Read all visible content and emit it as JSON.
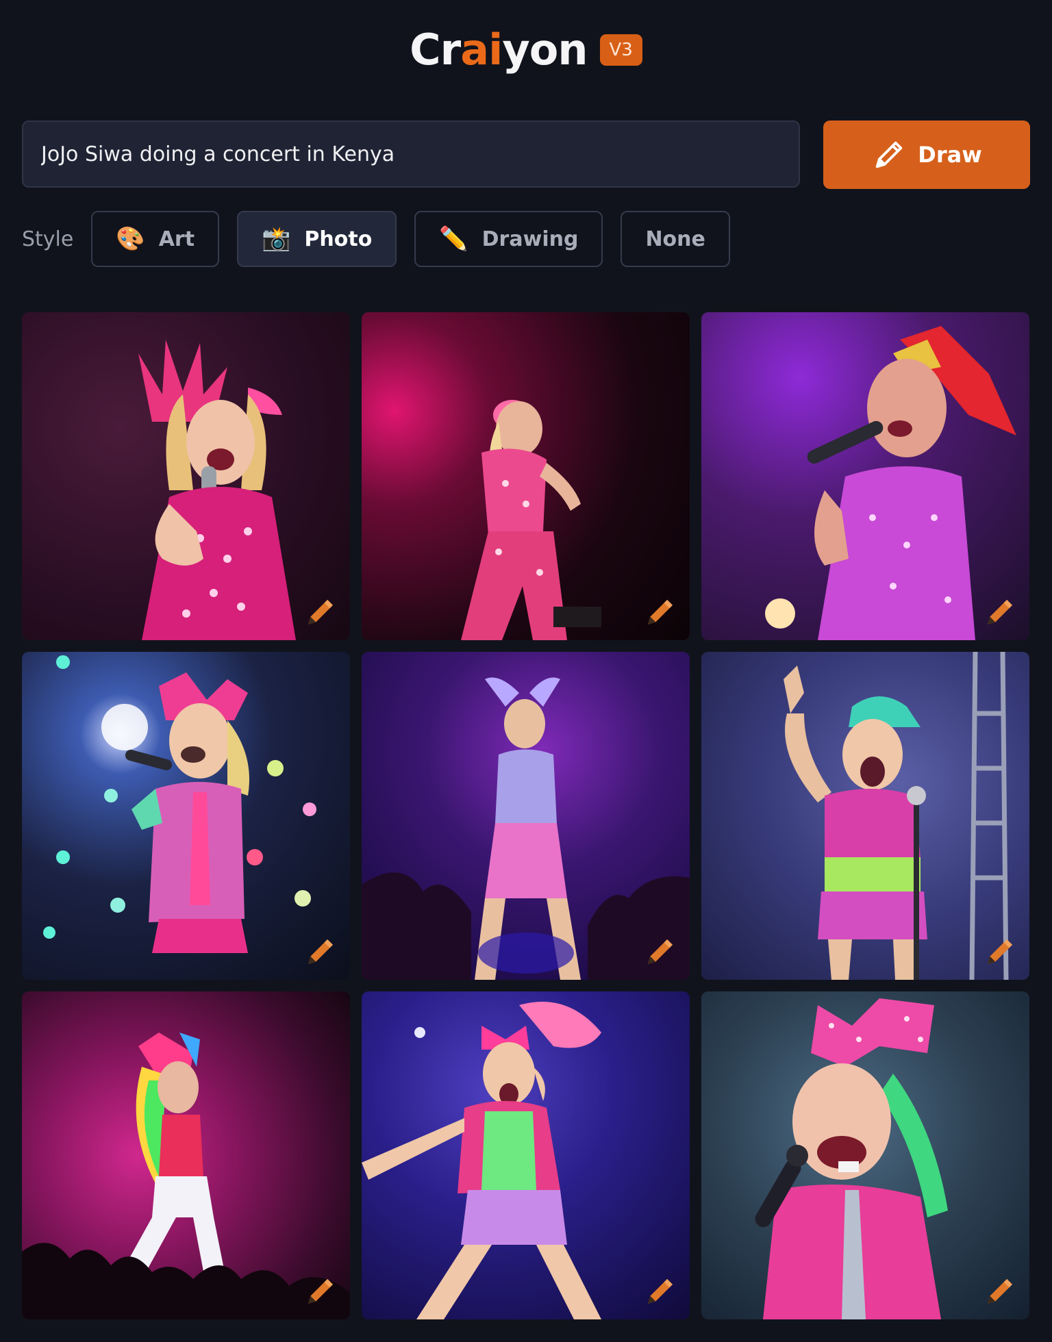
{
  "header": {
    "logo_prefix": "Cr",
    "logo_accent": "ai",
    "logo_suffix": "yon",
    "version_badge": "V3"
  },
  "prompt": {
    "value": "JoJo Siwa doing a concert in Kenya"
  },
  "draw_button": {
    "label": "Draw",
    "icon": "pencil-icon"
  },
  "style": {
    "label": "Style",
    "options": [
      {
        "label": "Art",
        "icon": "palette-icon",
        "emoji": "🎨",
        "selected": false
      },
      {
        "label": "Photo",
        "icon": "camera-flash-icon",
        "emoji": "📸",
        "selected": true
      },
      {
        "label": "Drawing",
        "icon": "pencil-icon",
        "emoji": "✏️",
        "selected": false
      },
      {
        "label": "None",
        "icon": "",
        "emoji": "",
        "selected": false
      }
    ]
  },
  "results": {
    "count": 9,
    "edit_icon": "pencil-edit-icon"
  },
  "colors": {
    "background": "#11131c",
    "accent": "#d6601b",
    "input_bg": "#1f2333"
  }
}
